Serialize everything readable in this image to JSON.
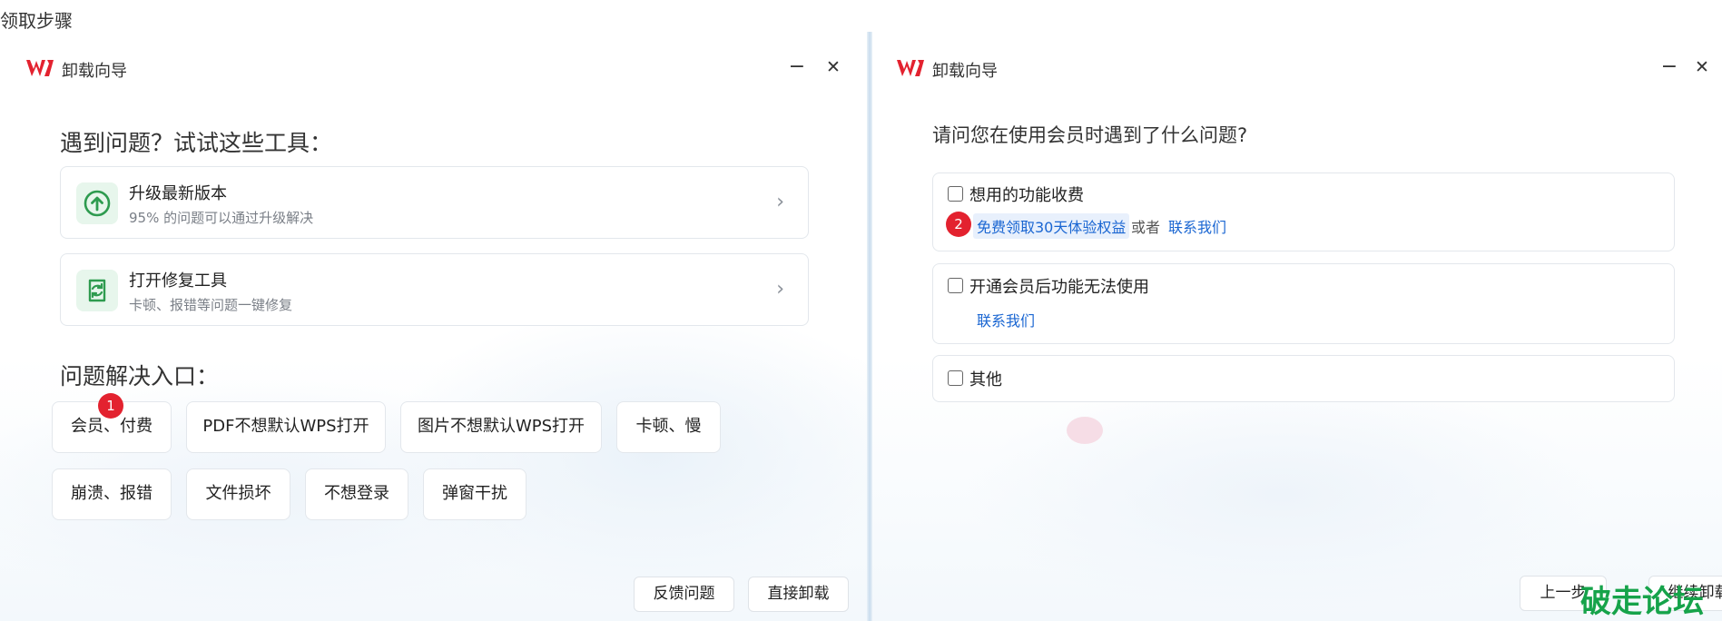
{
  "page": {
    "heading": "领取步骤"
  },
  "left_window": {
    "title": "卸载向导",
    "minimize_glyph": "−",
    "close_glyph": "✕",
    "tools_title": "遇到问题？试试这些工具：",
    "tools": [
      {
        "title": "升级最新版本",
        "subtitle": "95% 的问题可以通过升级解决",
        "icon": "upgrade-arrow-icon"
      },
      {
        "title": "打开修复工具",
        "subtitle": "卡顿、报错等问题一键修复",
        "icon": "repair-tool-icon"
      }
    ],
    "chevron_glyph": "›",
    "entry_title": "问题解决入口：",
    "entries_row1": [
      "会员、付费",
      "PDF不想默认WPS打开",
      "图片不想默认WPS打开",
      "卡顿、慢"
    ],
    "entries_row2": [
      "崩溃、报错",
      "文件损坏",
      "不想登录",
      "弹窗干扰"
    ],
    "marker": "1",
    "footer": {
      "feedback": "反馈问题",
      "uninstall": "直接卸载"
    }
  },
  "right_window": {
    "title": "卸载向导",
    "minimize_glyph": "−",
    "close_glyph": "✕",
    "question": "请问您在使用会员时遇到了什么问题?",
    "options": [
      {
        "label": "想用的功能收费",
        "link_primary": "免费领取30天体验权益",
        "or_text": "或者",
        "link_secondary": "联系我们"
      },
      {
        "label": "开通会员后功能无法使用",
        "link": "联系我们"
      },
      {
        "label": "其他"
      }
    ],
    "marker": "2",
    "footer": {
      "back": "上一步",
      "next": "继续卸载"
    }
  },
  "watermark": "破走论坛",
  "colors": {
    "accent": "#1a66d2",
    "marker": "#e3222f",
    "logo": "#e3222f",
    "icon_green": "#2e9b4f",
    "watermark": "#16a34a"
  }
}
